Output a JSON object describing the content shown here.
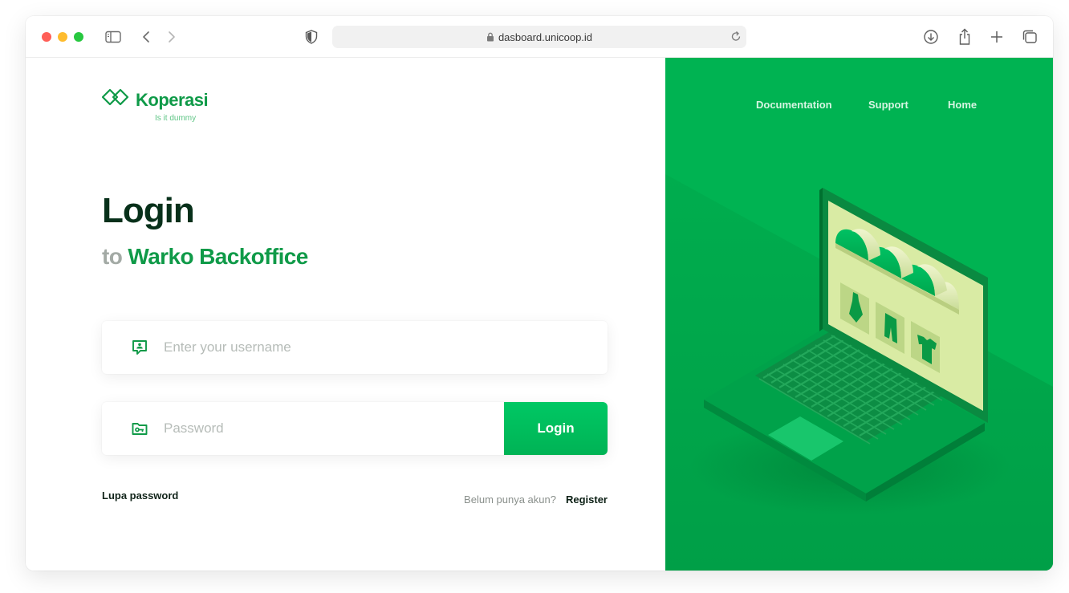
{
  "browser": {
    "url": "dasboard.unicoop.id",
    "icons": [
      "sidebar-icon",
      "back-icon",
      "forward-icon",
      "shield-icon",
      "lock-icon",
      "reload-icon",
      "download-icon",
      "share-icon",
      "new-tab-icon",
      "tabs-icon"
    ]
  },
  "brand": {
    "name": "Koperasi",
    "tagline": "Is it dummy",
    "color": "#0f9a48"
  },
  "heading": {
    "title": "Login",
    "subtitle_prefix": "to",
    "subtitle_brand": "Warko Backoffice"
  },
  "form": {
    "username_placeholder": "Enter your username",
    "username_value": "",
    "password_placeholder": "Password",
    "password_value": "",
    "login_label": "Login",
    "forgot_label": "Lupa password",
    "register_question": "Belum punya akun?",
    "register_label": "Register"
  },
  "nav": {
    "items": [
      "Documentation",
      "Support",
      "Home"
    ]
  },
  "colors": {
    "panel_green": "#00b050",
    "button_green": "#00c864",
    "heading_dark": "#07301a"
  }
}
